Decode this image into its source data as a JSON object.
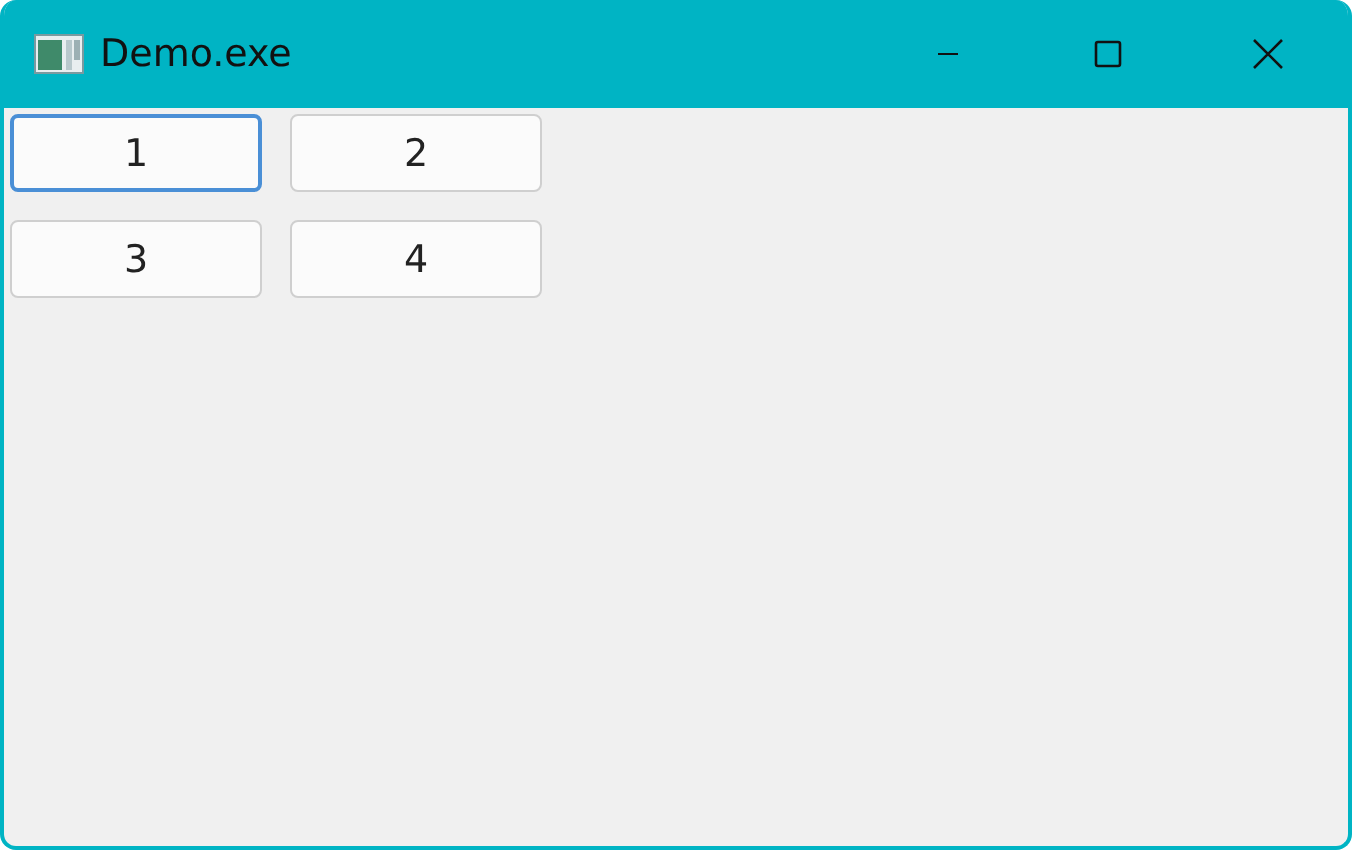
{
  "window": {
    "title": "Demo.exe"
  },
  "buttons": [
    {
      "label": "1",
      "focused": true
    },
    {
      "label": "2",
      "focused": false
    },
    {
      "label": "3",
      "focused": false
    },
    {
      "label": "4",
      "focused": false
    }
  ]
}
